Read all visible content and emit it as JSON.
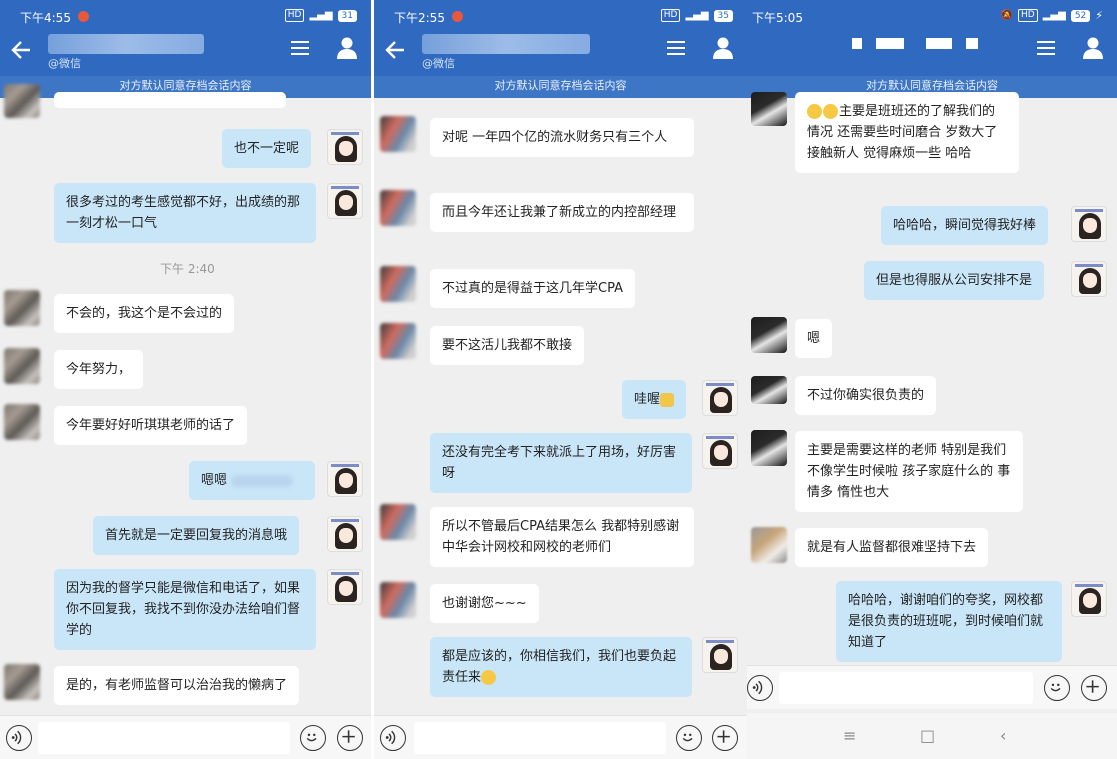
{
  "panels": [
    {
      "status_time": "下午4:55",
      "battery": "31",
      "contact_sub": "@微信",
      "notice": "对方默认同意存档会话内容",
      "timestamp": "下午 2:40",
      "messages": [
        {
          "side": "right",
          "text": "也不一定呢"
        },
        {
          "side": "right",
          "text": "很多考过的考生感觉都不好，出成绩的那一刻才松一口气"
        },
        {
          "side": "left",
          "text": "不会的，我这个是不会过的"
        },
        {
          "side": "left",
          "text": "今年努力，"
        },
        {
          "side": "left",
          "text": "今年要好好听琪琪老师的话了"
        },
        {
          "side": "right",
          "text": "嗯嗯"
        },
        {
          "side": "right",
          "text": "首先就是一定要回复我的消息哦"
        },
        {
          "side": "right",
          "text": "因为我的督学只能是微信和电话了，如果你不回复我，我找不到你没办法给咱们督学的"
        },
        {
          "side": "left",
          "text": "是的，有老师监督可以治治我的懒病了"
        }
      ]
    },
    {
      "status_time": "下午2:55",
      "battery": "35",
      "contact_sub": "@微信",
      "notice": "对方默认同意存档会话内容",
      "messages": [
        {
          "side": "left",
          "text": "对呢 一年四个亿的流水财务只有三个人"
        },
        {
          "side": "left",
          "text": "而且今年还让我兼了新成立的内控部经理"
        },
        {
          "side": "left",
          "text": "不过真的是得益于这几年学CPA"
        },
        {
          "side": "left",
          "text": "要不这活儿我都不敢接"
        },
        {
          "side": "right",
          "text": "哇喔"
        },
        {
          "side": "right",
          "text": "还没有完全考下来就派上了用场，好厉害呀"
        },
        {
          "side": "left",
          "text": "所以不管最后CPA结果怎么 我都特别感谢中华会计网校和网校的老师们"
        },
        {
          "side": "left",
          "text": "也谢谢您~~~"
        },
        {
          "side": "right",
          "text": "都是应该的，你相信我们，我们也要负起责任来"
        }
      ]
    },
    {
      "status_time": "下午5:05",
      "battery": "52",
      "notice": "对方默认同意存档会话内容",
      "messages": [
        {
          "side": "left",
          "text": "主要是班班还的了解我们的情况 还需要些时间磨合 岁数大了 接触新人 觉得麻烦一些 哈哈"
        },
        {
          "side": "right",
          "text": "哈哈哈，瞬间觉得我好棒"
        },
        {
          "side": "right",
          "text": "但是也得服从公司安排不是"
        },
        {
          "side": "left",
          "text": "嗯"
        },
        {
          "side": "left",
          "text": "不过你确实很负责的"
        },
        {
          "side": "left",
          "text": "主要是需要这样的老师 特别是我们不像学生时候啦 孩子家庭什么的 事情多 惰性也大"
        },
        {
          "side": "left",
          "text": "就是有人监督都很难坚持下去"
        },
        {
          "side": "right",
          "text": "哈哈哈，谢谢咱们的夸奖，网校都是很负责的班班呢，到时候咱们就知道了"
        }
      ]
    }
  ]
}
